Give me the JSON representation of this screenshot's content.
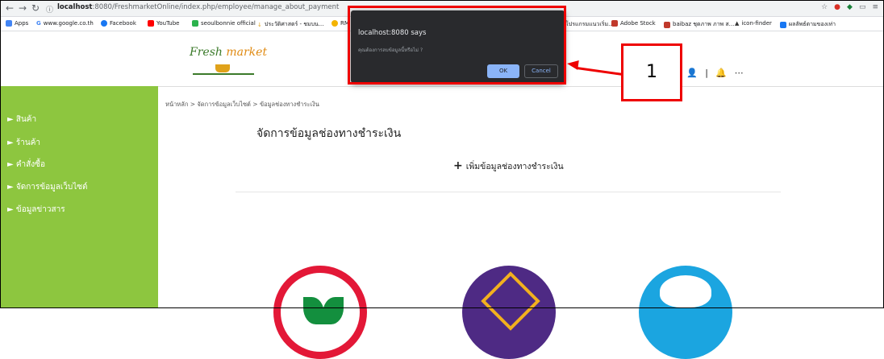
{
  "browser": {
    "url_host": "localhost",
    "url_path": ":8080/FreshmarketOnline/index.php/employee/manage_about_payment",
    "bookmarks": [
      "Apps",
      "www.google.co.th",
      "Facebook",
      "YouTube",
      "seoulbonnie official",
      "ประวัติศาสตร์ - ชมบน...",
      "RM",
      "โปรแกรมแนวเริ่ม...",
      "Adobe Stock",
      "baibaz ชุดภาพ ภาพ ส...",
      "icon-finder",
      "ผลลัพธ์ตามของเท่า"
    ]
  },
  "header": {
    "logo_text_a": "Fresh",
    "logo_text_b": "market",
    "icons": "👤 | 🔔 ⋯"
  },
  "sidebar": {
    "items": [
      "► สินค้า",
      "► ร้านค้า",
      "► คำสั่งซื้อ",
      "► จัดการข้อมูลเว็บไซต์",
      "► ข้อมูลข่าวสาร"
    ]
  },
  "main": {
    "breadcrumb": "หน้าหลัก > จัดการข้อมูลเว็บไซต์ > ข้อมูลช่องทางชำระเงิน",
    "title": "จัดการข้อมูลช่องทางชำระเงิน",
    "add_label": "เพิ่มข้อมูลช่องทางชำระเงิน"
  },
  "dialog": {
    "title": "localhost:8080 says",
    "message": "คุณต้องการลบข้อมูลนี้หรือไม่ ?",
    "ok": "OK",
    "cancel": "Cancel"
  },
  "annotation": {
    "label": "1",
    "color": "#ee0000"
  },
  "colors": {
    "sidebar": "#8dc63f",
    "dialog_bg": "#292a2d",
    "ok_button": "#8ab4f8"
  }
}
